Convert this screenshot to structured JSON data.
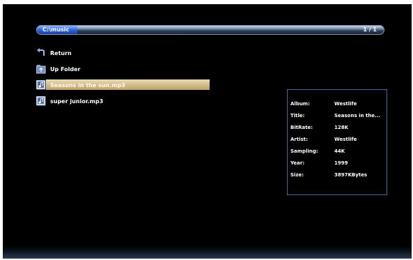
{
  "path_bar": {
    "path": "C:\\music",
    "page_counter": "1 / 1"
  },
  "file_list": {
    "items": [
      {
        "label": "Return",
        "icon": "return-arrow-icon"
      },
      {
        "label": "Up Folder",
        "icon": "folder-up-icon"
      },
      {
        "label": "Seasons in the sun.mp3",
        "icon": "music-file-icon",
        "selected": true
      },
      {
        "label": "super junior.mp3",
        "icon": "music-file-icon"
      }
    ]
  },
  "info_panel": {
    "rows": [
      {
        "key": "Album:",
        "value": "Westlife"
      },
      {
        "key": "Title:",
        "value": "Seasons in the..."
      },
      {
        "key": "BitRate:",
        "value": "128K"
      },
      {
        "key": "Artist:",
        "value": "Westlife"
      },
      {
        "key": "Sampling:",
        "value": "44K"
      },
      {
        "key": "Year:",
        "value": "1999"
      },
      {
        "key": "Size:",
        "value": "3897KBytes"
      }
    ]
  },
  "colors": {
    "background": "#000000",
    "selection": "#d4be8d",
    "panel_border": "#3d6e9f",
    "path_fill": "#2f66d8"
  }
}
